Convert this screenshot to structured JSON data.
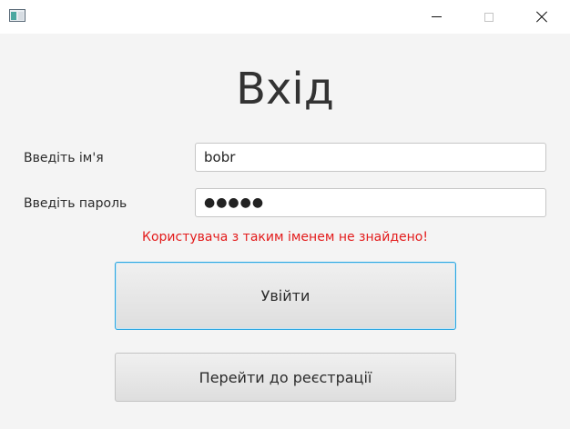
{
  "window": {
    "icon": "app-window-icon",
    "controls": [
      "minimize-icon",
      "maximize-icon",
      "close-icon"
    ]
  },
  "form": {
    "title": "Вхід",
    "username_label": "Введіть ім'я",
    "username_value": "bobr",
    "password_label": "Введіть пароль",
    "password_value": "●●●●●",
    "error_message": "Користувача з таким іменем не знайдено!",
    "login_button": "Увійти",
    "register_button": "Перейти до реєстрації"
  },
  "colors": {
    "error": "#e31c1c",
    "focus": "#2ba6e0",
    "background": "#f4f4f4"
  }
}
